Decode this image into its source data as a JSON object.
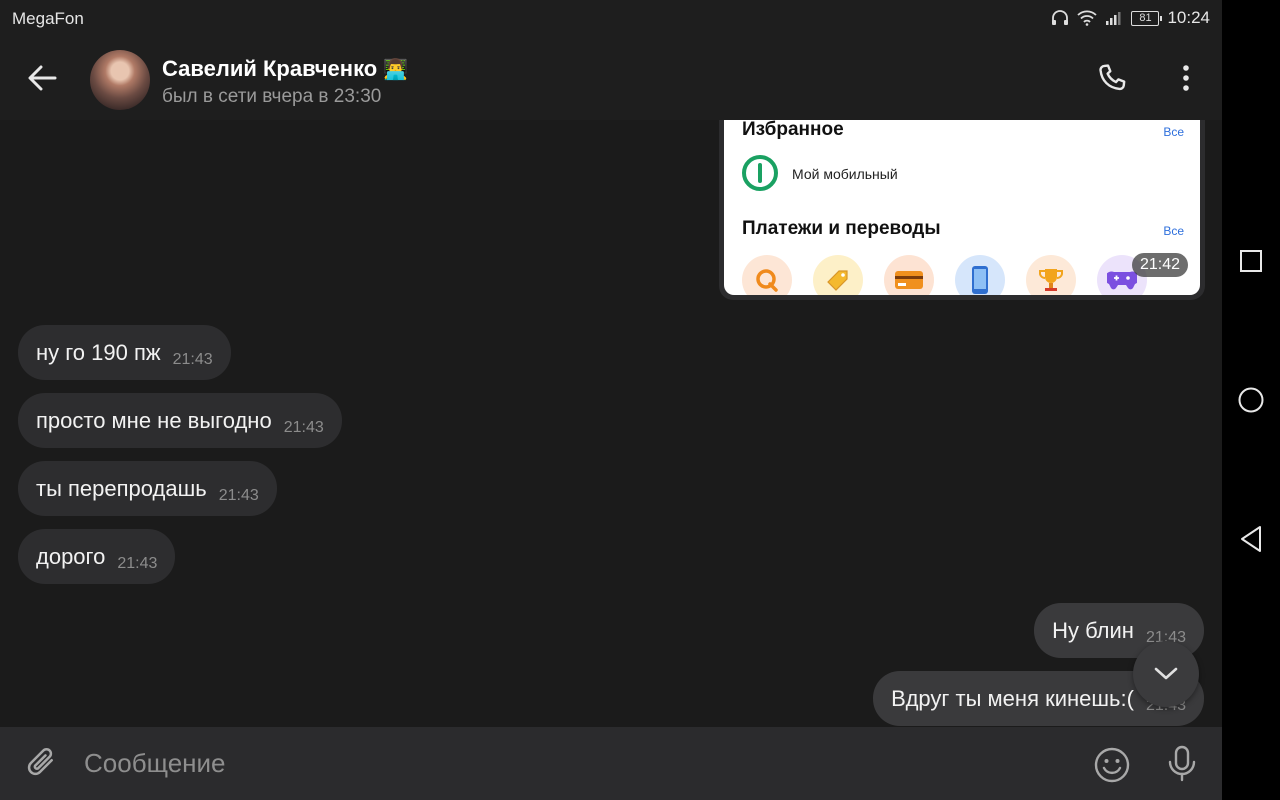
{
  "status_bar": {
    "carrier": "MegaFon",
    "battery": "81",
    "time": "10:24"
  },
  "header": {
    "contact_name": "Савелий Кравченко",
    "contact_emoji": "👨‍💻",
    "last_seen": "был в сети вчера в 23:30"
  },
  "image_message": {
    "favorites_title": "Избранное",
    "favorites_all": "Все",
    "favorite_item": "Мой мобильный",
    "payments_title": "Платежи и переводы",
    "payments_all": "Все",
    "time": "21:42"
  },
  "messages": [
    {
      "direction": "in",
      "text": "ну го 190 пж",
      "time": "21:43"
    },
    {
      "direction": "in",
      "text": "просто мне не выгодно",
      "time": "21:43"
    },
    {
      "direction": "in",
      "text": "ты перепродашь",
      "time": "21:43"
    },
    {
      "direction": "in",
      "text": "дорого",
      "time": "21:43"
    },
    {
      "direction": "out",
      "text": "Ну блин",
      "time": "21:43"
    },
    {
      "direction": "out",
      "text": "Вдруг ты меня кинешь:(",
      "time": "21:43"
    }
  ],
  "input": {
    "placeholder": "Сообщение"
  },
  "colors": {
    "background": "#1b1b1b",
    "bubble_in": "#2d2d2f",
    "bubble_out": "#3a3a3c",
    "accent_green": "#1aa162"
  }
}
